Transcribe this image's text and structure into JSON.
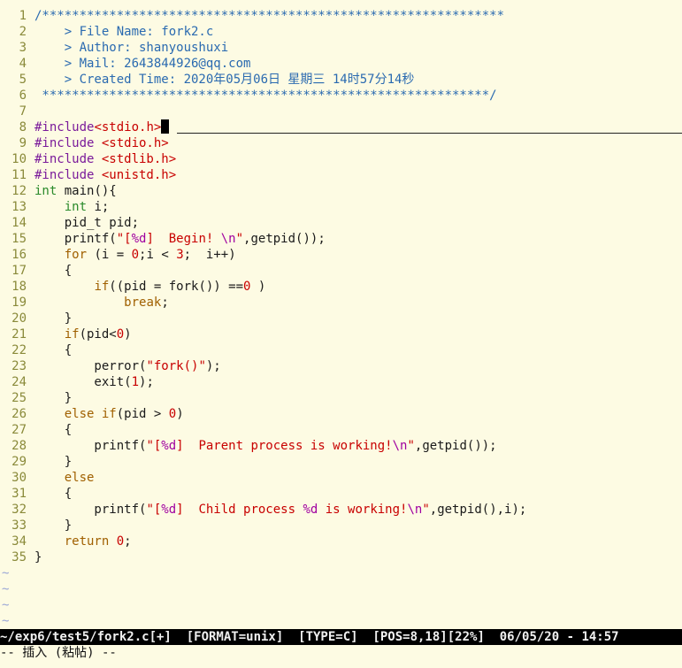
{
  "buffer": {
    "lines": [
      {
        "n": "1",
        "segs": [
          [
            "/**************************************************************",
            "c"
          ]
        ]
      },
      {
        "n": "2",
        "segs": [
          [
            "    > File Name: fork2.c",
            "c"
          ]
        ]
      },
      {
        "n": "3",
        "segs": [
          [
            "    > Author: shanyoushuxi",
            "c"
          ]
        ]
      },
      {
        "n": "4",
        "segs": [
          [
            "    > Mail: 2643844926@qq.com",
            "c"
          ]
        ]
      },
      {
        "n": "5",
        "segs": [
          [
            "    > Created Time: 2020年05月06日 星期三 14时57分14秒",
            "c"
          ]
        ]
      },
      {
        "n": "6",
        "segs": [
          [
            " ************************************************************/",
            "c"
          ]
        ]
      },
      {
        "n": "7",
        "segs": []
      },
      {
        "n": "8",
        "segs": [
          [
            "#include",
            "p"
          ],
          [
            "<stdio.h>",
            "s"
          ]
        ],
        "cursor": true
      },
      {
        "n": "9",
        "segs": [
          [
            "#include ",
            "p"
          ],
          [
            "<stdio.h>",
            "s"
          ]
        ]
      },
      {
        "n": "10",
        "segs": [
          [
            "#include ",
            "p"
          ],
          [
            "<stdlib.h>",
            "s"
          ]
        ]
      },
      {
        "n": "11",
        "segs": [
          [
            "#include ",
            "p"
          ],
          [
            "<unistd.h>",
            "s"
          ]
        ]
      },
      {
        "n": "12",
        "segs": [
          [
            "int",
            "t"
          ],
          [
            " main(){",
            "n"
          ]
        ]
      },
      {
        "n": "13",
        "segs": [
          [
            "    ",
            "n"
          ],
          [
            "int",
            "t"
          ],
          [
            " i;",
            "n"
          ]
        ]
      },
      {
        "n": "14",
        "segs": [
          [
            "    pid_t pid;",
            "n"
          ]
        ]
      },
      {
        "n": "15",
        "segs": [
          [
            "    printf(",
            "n"
          ],
          [
            "\"[",
            "s"
          ],
          [
            "%d",
            "sp"
          ],
          [
            "]  Begin! ",
            "s"
          ],
          [
            "\\n",
            "sp"
          ],
          [
            "\"",
            "s"
          ],
          [
            ",getpid());",
            "n"
          ]
        ]
      },
      {
        "n": "16",
        "segs": [
          [
            "    ",
            "n"
          ],
          [
            "for",
            "k"
          ],
          [
            " (i = ",
            "n"
          ],
          [
            "0",
            "s"
          ],
          [
            ";i < ",
            "n"
          ],
          [
            "3",
            "s"
          ],
          [
            ";  i++)",
            "n"
          ]
        ]
      },
      {
        "n": "17",
        "segs": [
          [
            "    {",
            "n"
          ]
        ]
      },
      {
        "n": "18",
        "segs": [
          [
            "        ",
            "n"
          ],
          [
            "if",
            "k"
          ],
          [
            "((pid = fork()) ==",
            "n"
          ],
          [
            "0",
            "s"
          ],
          [
            " )",
            "n"
          ]
        ]
      },
      {
        "n": "19",
        "segs": [
          [
            "            ",
            "n"
          ],
          [
            "break",
            "k"
          ],
          [
            ";",
            "n"
          ]
        ]
      },
      {
        "n": "20",
        "segs": [
          [
            "    }",
            "n"
          ]
        ]
      },
      {
        "n": "21",
        "segs": [
          [
            "    ",
            "n"
          ],
          [
            "if",
            "k"
          ],
          [
            "(pid<",
            "n"
          ],
          [
            "0",
            "s"
          ],
          [
            ")",
            "n"
          ]
        ]
      },
      {
        "n": "22",
        "segs": [
          [
            "    {",
            "n"
          ]
        ]
      },
      {
        "n": "23",
        "segs": [
          [
            "        perror(",
            "n"
          ],
          [
            "\"fork()\"",
            "s"
          ],
          [
            ");",
            "n"
          ]
        ]
      },
      {
        "n": "24",
        "segs": [
          [
            "        exit(",
            "n"
          ],
          [
            "1",
            "s"
          ],
          [
            ");",
            "n"
          ]
        ]
      },
      {
        "n": "25",
        "segs": [
          [
            "    }",
            "n"
          ]
        ]
      },
      {
        "n": "26",
        "segs": [
          [
            "    ",
            "n"
          ],
          [
            "else",
            "k"
          ],
          [
            " ",
            "n"
          ],
          [
            "if",
            "k"
          ],
          [
            "(pid > ",
            "n"
          ],
          [
            "0",
            "s"
          ],
          [
            ")",
            "n"
          ]
        ]
      },
      {
        "n": "27",
        "segs": [
          [
            "    {",
            "n"
          ]
        ]
      },
      {
        "n": "28",
        "segs": [
          [
            "        printf(",
            "n"
          ],
          [
            "\"[",
            "s"
          ],
          [
            "%d",
            "sp"
          ],
          [
            "]  Parent process is working!",
            "s"
          ],
          [
            "\\n",
            "sp"
          ],
          [
            "\"",
            "s"
          ],
          [
            ",getpid());",
            "n"
          ]
        ]
      },
      {
        "n": "29",
        "segs": [
          [
            "    }",
            "n"
          ]
        ]
      },
      {
        "n": "30",
        "segs": [
          [
            "    ",
            "n"
          ],
          [
            "else",
            "k"
          ]
        ]
      },
      {
        "n": "31",
        "segs": [
          [
            "    {",
            "n"
          ]
        ]
      },
      {
        "n": "32",
        "segs": [
          [
            "        printf(",
            "n"
          ],
          [
            "\"[",
            "s"
          ],
          [
            "%d",
            "sp"
          ],
          [
            "]  Child process ",
            "s"
          ],
          [
            "%d",
            "sp"
          ],
          [
            " is working!",
            "s"
          ],
          [
            "\\n",
            "sp"
          ],
          [
            "\"",
            "s"
          ],
          [
            ",getpid(),i);",
            "n"
          ]
        ]
      },
      {
        "n": "33",
        "segs": [
          [
            "    }",
            "n"
          ]
        ]
      },
      {
        "n": "34",
        "segs": [
          [
            "    ",
            "n"
          ],
          [
            "return",
            "k"
          ],
          [
            " ",
            "n"
          ],
          [
            "0",
            "s"
          ],
          [
            ";",
            "n"
          ]
        ]
      },
      {
        "n": "35",
        "segs": [
          [
            "}",
            "n"
          ]
        ]
      }
    ],
    "empty_markers": [
      "~",
      "~",
      "~",
      "~"
    ]
  },
  "statusline": "~/exp6/test5/fork2.c[+]  [FORMAT=unix]  [TYPE=C]  [POS=8,18][22%]  06/05/20 - 14:57",
  "cmdline": "-- 插入 (粘帖) --",
  "colors": {
    "background": "#fdfbe3",
    "line_number": "#8a8a3a",
    "comment": "#2a6ab0",
    "preproc": "#7a1a9a",
    "string": "#c80000",
    "special": "#a000a0",
    "type": "#2a8a2a",
    "keyword": "#a06000",
    "normal": "#1a1a1a",
    "tilde": "#9aa6d6",
    "statusline_bg": "#000000",
    "statusline_fg": "#f0f0f0"
  }
}
